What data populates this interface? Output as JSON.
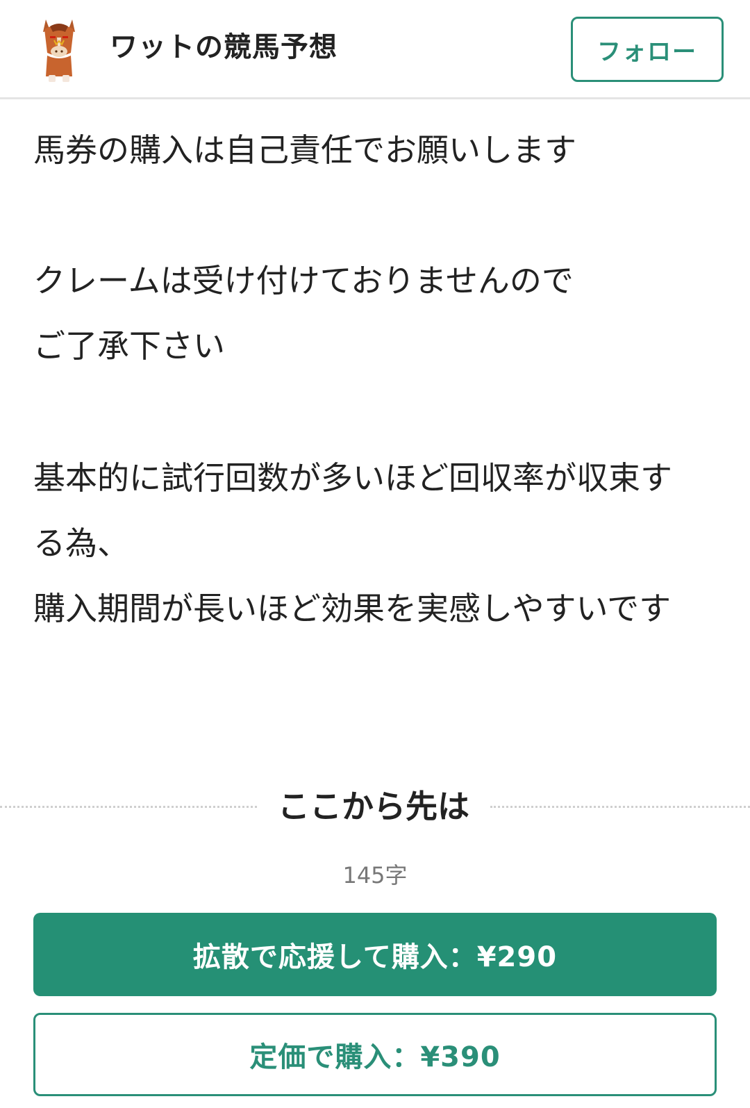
{
  "header": {
    "blog_title": "ワットの競馬予想",
    "follow_label": "フォロー",
    "avatar_icon": "horse-mascot-icon"
  },
  "article": {
    "lines": [
      "馬券の購入は自己責任でお願いします",
      "クレームは受け付けておりませんので",
      "ご了承下さい",
      "基本的に試行回数が多いほど回収率が収束す",
      "る為、",
      "購入期間が長いほど効果を実感しやすいです"
    ]
  },
  "paywall": {
    "divider_text": "ここから先は",
    "char_count": "145字",
    "share_buy_label": "拡散で応援して購入：¥290",
    "regular_buy_label": "定価で購入：¥390"
  },
  "colors": {
    "accent": "#259075",
    "text": "#222222",
    "muted": "#777777"
  }
}
